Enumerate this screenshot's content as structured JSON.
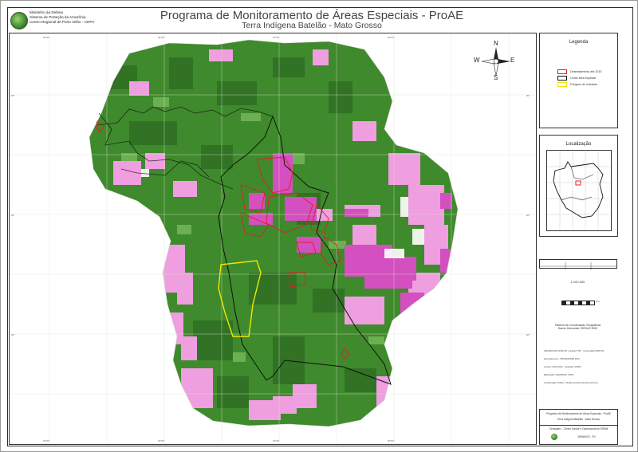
{
  "header": {
    "org_lines": [
      "Ministério da Defesa",
      "Sistema de Proteção da Amazônia",
      "Centro Regional de Porto Velho - CRPV"
    ],
    "title": "Programa de Monitoramento de Áreas Especiais - ProAE",
    "subtitle": "Terra Indígena Batelão - Mato Grosso"
  },
  "compass": {
    "n": "N",
    "s": "S",
    "e": "E",
    "w": "W"
  },
  "legend": {
    "title": "Legenda",
    "items": [
      {
        "label": "Desmatamento até 2010",
        "color": "#e02020"
      },
      {
        "label": "Limite área especial",
        "color": "#111111"
      },
      {
        "label": "Polígono de estradas",
        "color": "#f2e600"
      }
    ]
  },
  "localization": {
    "title": "Localização"
  },
  "scale": {
    "text": "1:100.000",
    "unit": "Km"
  },
  "coordinates": {
    "line1": "Sistema de Coordenadas Geográficas",
    "line2": "Datum Horizontal: SIRGAS 2000"
  },
  "notes": [
    "IMAGENS DE SATÉLITE: Landsat 5 TM – Composição RGB 543",
    "Desmatamento – PRODES/INPE 2010",
    "Limites: FUNAI 2010 – Estradas: SIPAM",
    "Elaboração: CENSIPAM / CRPV",
    "Coordenação: DITEC – Divisão de Sensoriamento Remoto"
  ],
  "footer": {
    "line1": "Programa de Monitoramento de Áreas Especiais - ProAE",
    "line2": "Terra Indígena Batelão - Mato Grosso",
    "line3": "Censipam – Centro Gestor e Operacional do SIPAM",
    "line4": "SIPAM/CR - PV"
  },
  "colors": {
    "forest": "#3f8a2c",
    "forest_dark": "#2f6e24",
    "deforest": "#d44fbf",
    "pasture": "#ef9ee0",
    "limit": "#111111",
    "deforest_poly": "#e02020",
    "road_poly": "#f2e600"
  }
}
